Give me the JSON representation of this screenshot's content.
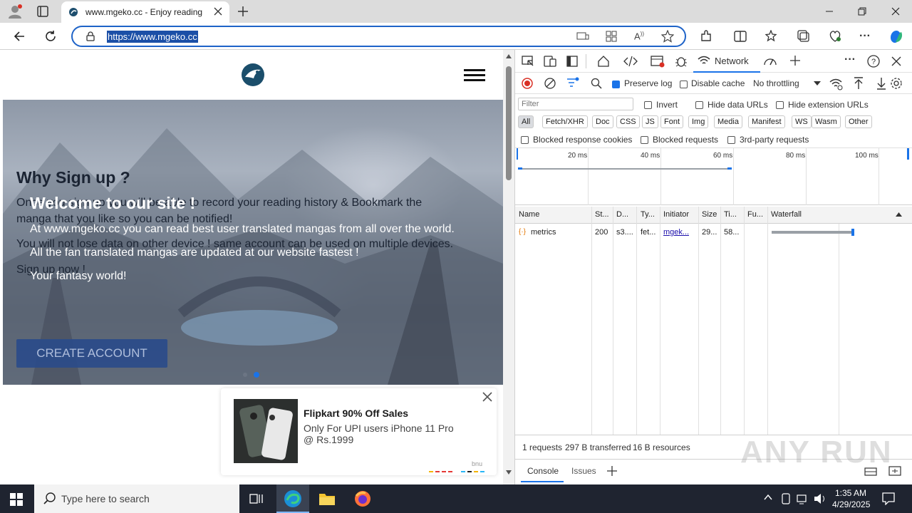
{
  "browser": {
    "tab_title": "www.mgeko.cc - Enjoy reading",
    "url": "https://www.mgeko.cc"
  },
  "page": {
    "hero": {
      "why_heading": "Why Sign up ?",
      "why_line1": "Once you sign up you will be able to record your reading history & Bookmark the",
      "why_line2": "manga that you like so you can be notified!",
      "why_line3": "You will not lose data on other device ! same account can be used on multiple devices.",
      "why_line4": "Sign up now !",
      "welcome_heading": "Welcome to our site !",
      "welcome_line1": "At www.mgeko.cc you can read best user translated mangas from all over the world.",
      "welcome_line2": "All the fan translated mangas are updated at our website fastest !",
      "welcome_line3": "Your fantasy world!",
      "create_button": "CREATE ACCOUNT"
    },
    "ad": {
      "title": "Flipkart 90% Off Sales",
      "line1": "Only For UPI users iPhone 11 Pro",
      "line2": "@ Rs.1999",
      "brand": "bnu"
    }
  },
  "devtools": {
    "tabs": {
      "network_label": "Network"
    },
    "toolbar": {
      "preserve_log": "Preserve log",
      "disable_cache": "Disable cache",
      "throttling": "No throttling"
    },
    "filter": {
      "placeholder": "Filter",
      "invert": "Invert",
      "hide_data_urls": "Hide data URLs",
      "hide_extension_urls": "Hide extension URLs"
    },
    "type_filters": [
      "All",
      "Fetch/XHR",
      "Doc",
      "CSS",
      "JS",
      "Font",
      "Img",
      "Media",
      "Manifest",
      "WS",
      "Wasm",
      "Other"
    ],
    "more_filters": {
      "blocked_response_cookies": "Blocked response cookies",
      "blocked_requests": "Blocked requests",
      "third_party": "3rd-party requests"
    },
    "timeline_ticks": [
      "20 ms",
      "40 ms",
      "60 ms",
      "80 ms",
      "100 ms"
    ],
    "columns": [
      "Name",
      "St...",
      "D...",
      "Ty...",
      "Initiator",
      "Size",
      "Ti...",
      "Fu...",
      "Waterfall"
    ],
    "rows": [
      {
        "name": "metrics",
        "status": "200",
        "domain": "s3....",
        "type": "fet...",
        "initiator": "mgek...",
        "size": "29...",
        "time": "58..."
      }
    ],
    "summary": {
      "requests": "1 requests",
      "transferred": "297 B transferred",
      "resources": "16 B resources"
    },
    "drawer": {
      "console": "Console",
      "issues": "Issues"
    }
  },
  "watermark": "ANY RUN",
  "taskbar": {
    "search_placeholder": "Type here to search",
    "time": "1:35 AM",
    "date": "4/29/2025"
  }
}
